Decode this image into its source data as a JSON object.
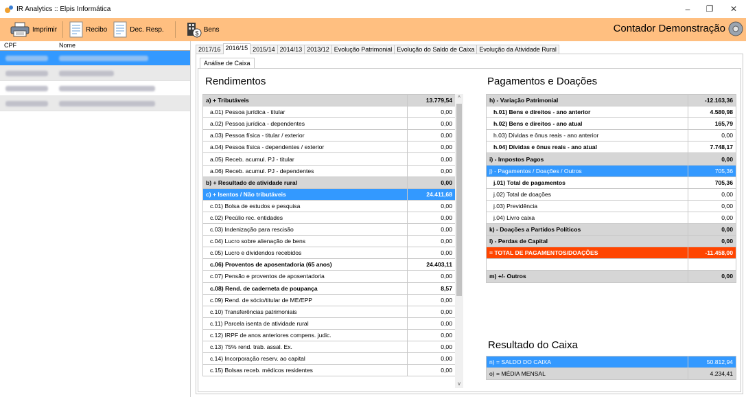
{
  "window": {
    "title": "IR Analytics :: Elpis Informática",
    "minimize": "–",
    "maximize": "❐",
    "close": "✕"
  },
  "toolbar": {
    "print_label": "Imprimir",
    "receipt_label": "Recibo",
    "decl_label": "Dec. Resp.",
    "assets_label": "Bens",
    "user_label": "Contador Demonstração"
  },
  "list": {
    "col_cpf": "CPF",
    "col_name": "Nome"
  },
  "tabs": [
    "2017/16",
    "2016/15",
    "2015/14",
    "2014/13",
    "2013/12",
    "Evolução Patrimonial",
    "Evolução do Saldo de Caixa",
    "Evolução da Atividade Rural"
  ],
  "subtab": "Análise de Caixa",
  "rendimentos": {
    "title": "Rendimentos",
    "rows": [
      {
        "label": "a) + Tributáveis",
        "value": "13.779,54"
      },
      {
        "label": "a.01) Pessoa jurídica - titular",
        "value": "0,00"
      },
      {
        "label": "a.02) Pessoa jurídica - dependentes",
        "value": "0,00"
      },
      {
        "label": "a.03) Pessoa física - titular / exterior",
        "value": "0,00"
      },
      {
        "label": "a.04) Pessoa física - dependentes / exterior",
        "value": "0,00"
      },
      {
        "label": "a.05) Receb. acumul. PJ - titular",
        "value": "0,00"
      },
      {
        "label": "a.06) Receb. acumul. PJ - dependentes",
        "value": "0,00"
      },
      {
        "label": "b) + Resultado de atividade rural",
        "value": "0,00"
      },
      {
        "label": "c) + Isentos / Não tributáveis",
        "value": "24.411,68"
      },
      {
        "label": "c.01) Bolsa de estudos e pesquisa",
        "value": "0,00"
      },
      {
        "label": "c.02) Pecúlio rec. entidades",
        "value": "0,00"
      },
      {
        "label": "c.03) Indenização para rescisão",
        "value": "0,00"
      },
      {
        "label": "c.04) Lucro sobre alienação de bens",
        "value": "0,00"
      },
      {
        "label": "c.05) Lucro e dividendos recebidos",
        "value": "0,00"
      },
      {
        "label": "c.06) Proventos de aposentadoria (65 anos)",
        "value": "24.403,11"
      },
      {
        "label": "c.07) Pensão e proventos de aposentadoria",
        "value": "0,00"
      },
      {
        "label": "c.08) Rend. de caderneta de poupança",
        "value": "8,57"
      },
      {
        "label": "c.09) Rend. de sócio/titular de ME/EPP",
        "value": "0,00"
      },
      {
        "label": "c.10) Transferências patrimoniais",
        "value": "0,00"
      },
      {
        "label": "c.11) Parcela isenta de atividade rural",
        "value": "0,00"
      },
      {
        "label": "c.12) IRPF de anos anteriores compens. judic.",
        "value": "0,00"
      },
      {
        "label": "c.13) 75% rend. trab. assal. Ex.",
        "value": "0,00"
      },
      {
        "label": "c.14) Incorporação reserv. ao capital",
        "value": "0,00"
      },
      {
        "label": "c.15) Bolsas receb. médicos residentes",
        "value": "0,00"
      }
    ]
  },
  "pagamentos": {
    "title": "Pagamentos e Doações",
    "rows": [
      {
        "label": "h) - Variação Patrimonial",
        "value": "-12.163,36"
      },
      {
        "label": "h.01) Bens e direitos - ano anterior",
        "value": "4.580,98"
      },
      {
        "label": "h.02) Bens e direitos - ano atual",
        "value": "165,79"
      },
      {
        "label": "h.03) Dívidas e ônus reais - ano anterior",
        "value": "0,00"
      },
      {
        "label": "h.04) Dívidas e ônus reais - ano atual",
        "value": "7.748,17"
      },
      {
        "label": "i) - Impostos Pagos",
        "value": "0,00"
      },
      {
        "label": "j) - Pagamentos / Doações / Outros",
        "value": "705,36"
      },
      {
        "label": "j.01) Total de pagamentos",
        "value": "705,36"
      },
      {
        "label": "j.02) Total de doações",
        "value": "0,00"
      },
      {
        "label": "j.03) Previdência",
        "value": "0,00"
      },
      {
        "label": "j.04) Livro caixa",
        "value": "0,00"
      },
      {
        "label": "k) - Doações a Partidos Políticos",
        "value": "0,00"
      },
      {
        "label": "l) - Perdas de Capital",
        "value": "0,00"
      },
      {
        "label": "= TOTAL DE PAGAMENTOS/DOAÇÕES",
        "value": "-11.458,00"
      },
      {
        "label": "",
        "value": ""
      },
      {
        "label": "m) +/- Outros",
        "value": "0,00"
      }
    ]
  },
  "resultado": {
    "title": "Resultado do Caixa",
    "rows": [
      {
        "label": "n) = SALDO DO CAIXA",
        "value": "50.812,94"
      },
      {
        "label": "o) = MÉDIA MENSAL",
        "value": "4.234,41"
      }
    ]
  }
}
